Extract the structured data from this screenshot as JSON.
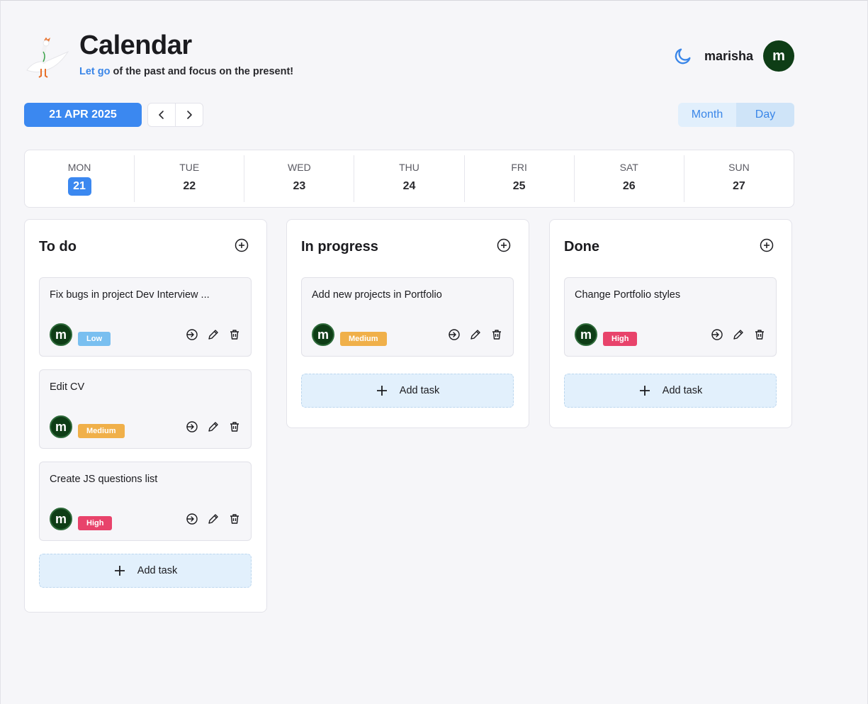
{
  "header": {
    "title": "Calendar",
    "subtitle_accent": "Let go",
    "subtitle_rest": "of the past and focus on the present!",
    "logo_icon": "goose-logo",
    "theme_icon": "moon-icon",
    "username": "marisha",
    "avatar_letter": "m"
  },
  "toolbar": {
    "current_date": "21 APR 2025",
    "prev_icon": "chevron-left-icon",
    "next_icon": "chevron-right-icon",
    "view_month": "Month",
    "view_day": "Day",
    "active_view": "Day"
  },
  "week": [
    {
      "name": "MON",
      "num": "21",
      "active": true
    },
    {
      "name": "TUE",
      "num": "22",
      "active": false
    },
    {
      "name": "WED",
      "num": "23",
      "active": false
    },
    {
      "name": "THU",
      "num": "24",
      "active": false
    },
    {
      "name": "FRI",
      "num": "25",
      "active": false
    },
    {
      "name": "SAT",
      "num": "26",
      "active": false
    },
    {
      "name": "SUN",
      "num": "27",
      "active": false
    }
  ],
  "columns": {
    "todo": {
      "title": "To do",
      "add_label": "Add task",
      "cards": [
        {
          "title": "Fix bugs in project Dev Interview ...",
          "avatar": "m",
          "priority": "Low"
        },
        {
          "title": "Edit CV",
          "avatar": "m",
          "priority": "Medium"
        },
        {
          "title": "Create JS questions list",
          "avatar": "m",
          "priority": "High"
        }
      ]
    },
    "progress": {
      "title": "In progress",
      "add_label": "Add task",
      "cards": [
        {
          "title": "Add new projects in Portfolio",
          "avatar": "m",
          "priority": "Medium"
        }
      ]
    },
    "done": {
      "title": "Done",
      "add_label": "Add task",
      "cards": [
        {
          "title": "Change Portfolio styles",
          "avatar": "m",
          "priority": "High"
        }
      ]
    }
  },
  "colors": {
    "accent": "#3b88f0",
    "low": "#79bff0",
    "medium": "#f0b04a",
    "high": "#e8436b",
    "avatar_bg": "#0e3d16"
  }
}
